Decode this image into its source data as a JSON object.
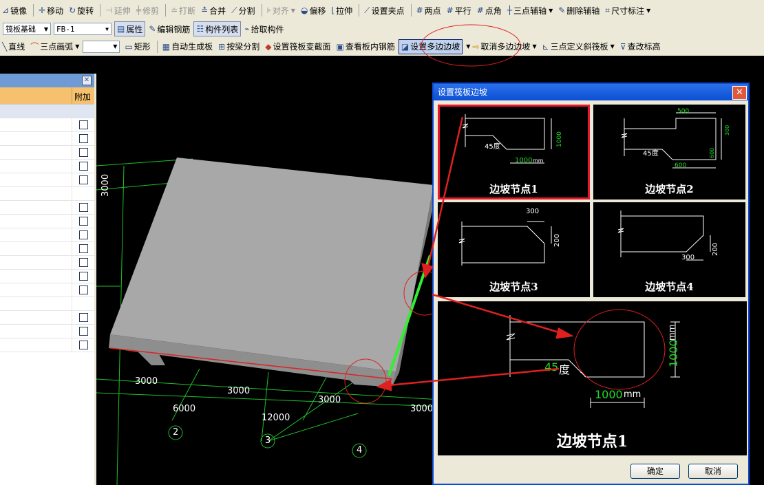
{
  "toolbar_row1": {
    "items": [
      "镜像",
      "移动",
      "旋转",
      "延伸",
      "修剪",
      "打断",
      "合并",
      "分割",
      "对齐",
      "偏移",
      "拉伸",
      "设置夹点",
      "两点",
      "平行",
      "点角",
      "三点辅轴",
      "删除辅轴",
      "尺寸标注"
    ]
  },
  "toolbar_row2": {
    "category_value": "筏板基础",
    "component_value": "FB-1",
    "items": [
      "属性",
      "编辑钢筋",
      "构件列表",
      "拾取构件"
    ]
  },
  "toolbar_row3": {
    "items": [
      "直线",
      "三点画弧",
      "矩形",
      "自动生成板",
      "按梁分割",
      "设置筏板变截面",
      "查看板内钢筋",
      "设置多边边坡",
      "取消多边边坡",
      "三点定义斜筏板",
      "查改标高"
    ]
  },
  "property_panel": {
    "column_header": "附加"
  },
  "viewport": {
    "dimensions": {
      "side": "3000",
      "front_a": "3000",
      "front_b": "3000",
      "front_c": "3000",
      "front_d": "3000",
      "total_a": "6000",
      "total_b": "12000"
    },
    "axis_labels": [
      "2",
      "3",
      "4"
    ]
  },
  "dialog": {
    "title": "设置筏板边坡",
    "options": [
      {
        "caption": "边坡节点1",
        "angle": "45度",
        "dim_w": "1000",
        "dim_h": "1000",
        "unit": "mm"
      },
      {
        "caption": "边坡节点2",
        "angle": "45度",
        "dim_w_top": "500",
        "dim_h1": "300",
        "dim_h2": "600",
        "dim_w_bottom": "600",
        "unit": "mm"
      },
      {
        "caption": "边坡节点3",
        "dim_w": "300",
        "dim_h": "200",
        "unit": "mm"
      },
      {
        "caption": "边坡节点4",
        "dim_w": "300",
        "dim_h": "200",
        "unit": "mm"
      }
    ],
    "preview": {
      "caption": "边坡节点1",
      "angle_value": "45",
      "angle_unit": "度",
      "dim_w": "1000",
      "dim_h": "1000",
      "unit": "mm"
    },
    "ok_label": "确定",
    "cancel_label": "取消"
  },
  "colors": {
    "dialog_title": "#0c4fd4",
    "selection": "#e8182a",
    "grid": "#1fbf2a",
    "dim_green": "#22dd22"
  }
}
